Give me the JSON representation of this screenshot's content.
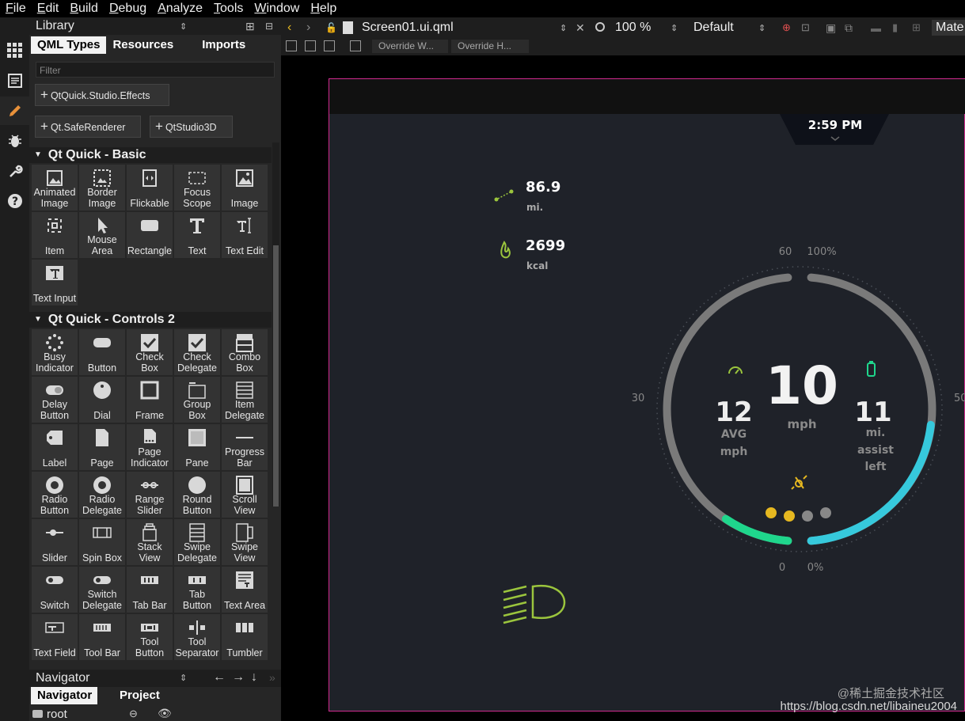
{
  "menu": [
    "File",
    "Edit",
    "Build",
    "Debug",
    "Analyze",
    "Tools",
    "Window",
    "Help"
  ],
  "library": {
    "title": "Library",
    "tabs": [
      "QML Types",
      "Resources",
      "Imports"
    ],
    "filter_placeholder": "Filter",
    "imports": [
      "QtQuick.Studio.Effects",
      "Qt.SafeRenderer",
      "QtStudio3D"
    ],
    "sections": [
      {
        "title": "Qt Quick - Basic",
        "items": [
          {
            "l1": "Animated",
            "l2": "Image",
            "icon": "animated-image-icon"
          },
          {
            "l1": "Border",
            "l2": "Image",
            "icon": "border-image-icon"
          },
          {
            "l1": "",
            "l2": "Flickable",
            "icon": "flickable-icon"
          },
          {
            "l1": "Focus",
            "l2": "Scope",
            "icon": "focus-scope-icon"
          },
          {
            "l1": "",
            "l2": "Image",
            "icon": "image-icon"
          },
          {
            "l1": "",
            "l2": "Item",
            "icon": "item-icon"
          },
          {
            "l1": "Mouse",
            "l2": "Area",
            "icon": "mouse-area-icon"
          },
          {
            "l1": "",
            "l2": "Rectangle",
            "icon": "rectangle-icon"
          },
          {
            "l1": "",
            "l2": "Text",
            "icon": "text-icon"
          },
          {
            "l1": "",
            "l2": "Text Edit",
            "icon": "text-edit-icon"
          },
          {
            "l1": "",
            "l2": "Text Input",
            "icon": "text-input-icon"
          }
        ]
      },
      {
        "title": "Qt Quick - Controls 2",
        "items": [
          {
            "l1": "Busy",
            "l2": "Indicator",
            "icon": "busy-indicator-icon"
          },
          {
            "l1": "",
            "l2": "Button",
            "icon": "button-icon"
          },
          {
            "l1": "Check",
            "l2": "Box",
            "icon": "check-box-icon"
          },
          {
            "l1": "Check",
            "l2": "Delegate",
            "icon": "check-delegate-icon"
          },
          {
            "l1": "Combo",
            "l2": "Box",
            "icon": "combo-box-icon"
          },
          {
            "l1": "Delay",
            "l2": "Button",
            "icon": "delay-button-icon"
          },
          {
            "l1": "",
            "l2": "Dial",
            "icon": "dial-icon"
          },
          {
            "l1": "",
            "l2": "Frame",
            "icon": "frame-icon"
          },
          {
            "l1": "Group",
            "l2": "Box",
            "icon": "group-box-icon"
          },
          {
            "l1": "Item",
            "l2": "Delegate",
            "icon": "item-delegate-icon"
          },
          {
            "l1": "",
            "l2": "Label",
            "icon": "label-icon"
          },
          {
            "l1": "",
            "l2": "Page",
            "icon": "page-icon"
          },
          {
            "l1": "Page",
            "l2": "Indicator",
            "icon": "page-indicator-icon"
          },
          {
            "l1": "",
            "l2": "Pane",
            "icon": "pane-icon"
          },
          {
            "l1": "Progress",
            "l2": "Bar",
            "icon": "progress-bar-icon"
          },
          {
            "l1": "Radio",
            "l2": "Button",
            "icon": "radio-button-icon"
          },
          {
            "l1": "Radio",
            "l2": "Delegate",
            "icon": "radio-delegate-icon"
          },
          {
            "l1": "Range",
            "l2": "Slider",
            "icon": "range-slider-icon"
          },
          {
            "l1": "Round",
            "l2": "Button",
            "icon": "round-button-icon"
          },
          {
            "l1": "Scroll",
            "l2": "View",
            "icon": "scroll-view-icon"
          },
          {
            "l1": "",
            "l2": "Slider",
            "icon": "slider-icon"
          },
          {
            "l1": "",
            "l2": "Spin Box",
            "icon": "spin-box-icon"
          },
          {
            "l1": "Stack",
            "l2": "View",
            "icon": "stack-view-icon"
          },
          {
            "l1": "Swipe",
            "l2": "Delegate",
            "icon": "swipe-delegate-icon"
          },
          {
            "l1": "Swipe",
            "l2": "View",
            "icon": "swipe-view-icon"
          },
          {
            "l1": "",
            "l2": "Switch",
            "icon": "switch-icon"
          },
          {
            "l1": "Switch",
            "l2": "Delegate",
            "icon": "switch-delegate-icon"
          },
          {
            "l1": "",
            "l2": "Tab Bar",
            "icon": "tab-bar-icon"
          },
          {
            "l1": "Tab",
            "l2": "Button",
            "icon": "tab-button-icon"
          },
          {
            "l1": "",
            "l2": "Text Area",
            "icon": "text-area-icon"
          },
          {
            "l1": "",
            "l2": "Text Field",
            "icon": "text-field-icon"
          },
          {
            "l1": "",
            "l2": "Tool Bar",
            "icon": "tool-bar-icon"
          },
          {
            "l1": "Tool",
            "l2": "Button",
            "icon": "tool-button-icon"
          },
          {
            "l1": "Tool",
            "l2": "Separator",
            "icon": "tool-separator-icon"
          },
          {
            "l1": "",
            "l2": "Tumbler",
            "icon": "tumbler-icon"
          }
        ]
      }
    ]
  },
  "navigator": {
    "title": "Navigator",
    "tabs": [
      "Navigator",
      "Project"
    ],
    "root": "root"
  },
  "editor": {
    "file_name": "Screen01.ui.qml",
    "zoom": "100 %",
    "style": "Default",
    "overflow_label": "Mate",
    "override_width": "Override W...",
    "override_height": "Override H..."
  },
  "dashboard": {
    "time": "2:59 PM",
    "distance_value": "86.9",
    "distance_unit": "mi.",
    "calories_value": "2699",
    "calories_unit": "kcal",
    "tick_60": "60",
    "tick_100pct": "100%",
    "tick_30": "30",
    "tick_50": "50",
    "tick_0": "0",
    "tick_0pct": "0%",
    "avg_value": "12",
    "avg_l1": "AVG",
    "avg_l2": "mph",
    "speed_value": "10",
    "speed_unit": "mph",
    "assist_value": "11",
    "assist_l1": "mi.",
    "assist_l2": "assist",
    "assist_l3": "left",
    "speed_fraction": 0.17,
    "battery_fraction": 0.46
  },
  "watermark": {
    "line1": "@稀土掘金技术社区",
    "line2": "https://blog.csdn.net/libaineu2004"
  },
  "colors": {
    "accent_green": "#9bc53d",
    "speed_green": "#1fd68c",
    "battery_cyan": "#36c9dc",
    "artboard_border": "#d12b8f",
    "dot_yellow": "#e6b820"
  }
}
